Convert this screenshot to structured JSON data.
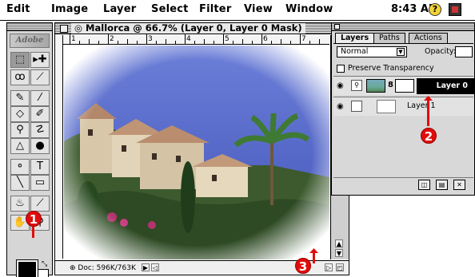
{
  "menubar": {
    "items": [
      "Edit",
      "Image",
      "Layer",
      "Select",
      "Filter",
      "View",
      "Window"
    ],
    "clock": "8:43 AM",
    "help_icon": "?"
  },
  "toolbox": {
    "logo_text": "Adobe",
    "tools": [
      {
        "name": "marquee-tool",
        "glyph": "⬚"
      },
      {
        "name": "move-tool",
        "glyph": "▸✚"
      },
      {
        "name": "lasso-tool",
        "glyph": "ꝏ"
      },
      {
        "name": "magic-wand-tool",
        "glyph": "⟋"
      },
      {
        "name": "airbrush-tool",
        "glyph": "✎"
      },
      {
        "name": "paintbrush-tool",
        "glyph": "⁄"
      },
      {
        "name": "eraser-tool",
        "glyph": "◇"
      },
      {
        "name": "pencil-tool",
        "glyph": "✐"
      },
      {
        "name": "rubber-stamp-tool",
        "glyph": "⚲"
      },
      {
        "name": "smudge-tool",
        "glyph": "☡"
      },
      {
        "name": "blur-tool",
        "glyph": "△"
      },
      {
        "name": "dodge-tool",
        "glyph": "●"
      },
      {
        "name": "pen-tool",
        "glyph": "⚬"
      },
      {
        "name": "type-tool",
        "glyph": "T"
      },
      {
        "name": "line-tool",
        "glyph": "╲"
      },
      {
        "name": "gradient-tool",
        "glyph": "▭"
      },
      {
        "name": "paint-bucket-tool",
        "glyph": "♨"
      },
      {
        "name": "eyedropper-tool",
        "glyph": "⟋"
      },
      {
        "name": "hand-tool",
        "glyph": "✋"
      },
      {
        "name": "zoom-tool",
        "glyph": "⚲"
      }
    ]
  },
  "document": {
    "title": "Mallorca @ 66.7% (Layer 0, Layer 0 Mask)",
    "ruler_numbers": [
      "1",
      "2",
      "3",
      "4",
      "5",
      "6",
      "7"
    ],
    "doc_size": "Doc: 596K/763K"
  },
  "layers_palette": {
    "tabs": [
      "Layers",
      "Paths",
      "Actions"
    ],
    "blend_mode": "Normal",
    "opacity_label": "Opacity:",
    "preserve_label": "Preserve Transparency",
    "layers": [
      {
        "name": "Layer 0",
        "selected": true
      },
      {
        "name": "Layer 1",
        "selected": false
      }
    ]
  },
  "callouts": [
    "1",
    "2",
    "3"
  ],
  "colors": {
    "callout_red": "#e10c0c",
    "sky": "#4f63c9",
    "foreground": "#000000",
    "background": "#ffffff"
  }
}
